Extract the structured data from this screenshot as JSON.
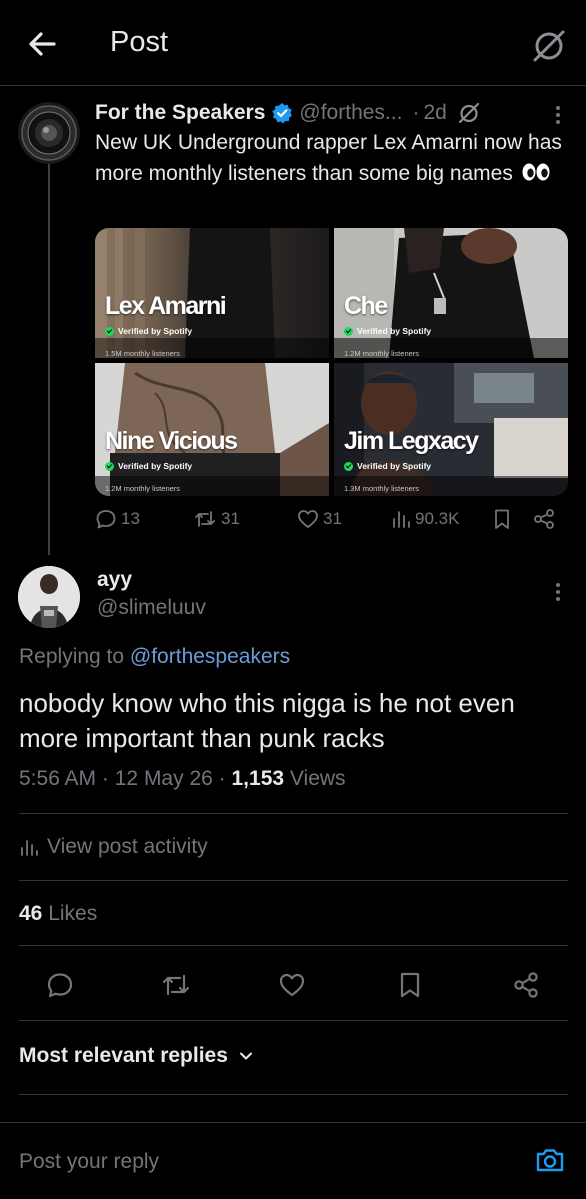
{
  "header": {
    "title": "Post",
    "back_icon": "arrow-left-icon",
    "right_icon": "grok-icon"
  },
  "quoted_tweet": {
    "author_name": "For the Speakers",
    "handle": "@forthes...",
    "time": "2d",
    "separator": "·",
    "text": "New UK Underground rapper Lex Amarni now has more monthly listeners than some big names",
    "emoji": "eyes-emoji",
    "media": [
      {
        "name": "Lex Amarni",
        "verified_text": "Verified by Spotify",
        "listeners": "1.5M monthly listeners"
      },
      {
        "name": "Che",
        "verified_text": "Verified by Spotify",
        "listeners": "1.2M monthly listeners"
      },
      {
        "name": "Nine Vicious",
        "verified_text": "Verified by Spotify",
        "listeners": "1.2M monthly listeners"
      },
      {
        "name": "Jim Legxacy",
        "verified_text": "Verified by Spotify",
        "listeners": "1.3M monthly listeners"
      }
    ],
    "stats": {
      "replies": "13",
      "reposts": "31",
      "likes": "31",
      "views": "90.3K"
    }
  },
  "reply": {
    "author_name": "ayy",
    "handle": "@slimeluuv",
    "replying_prefix": "Replying to",
    "replying_handle": "@forthespeakers",
    "text": "nobody know who this nigga is he not even more important than punk racks",
    "time": "5:56 AM",
    "date": "12 May 26",
    "dot": "·",
    "views_count": "1,153",
    "views_label": "Views"
  },
  "activity": {
    "label": "View post activity"
  },
  "likes_row": {
    "count": "46",
    "label": "Likes"
  },
  "sort": {
    "label": "Most relevant replies"
  },
  "compose": {
    "placeholder": "Post your reply"
  },
  "colors": {
    "background": "#000000",
    "text_primary": "#e7e9ea",
    "text_secondary": "#71767b",
    "link": "#6c9bd9",
    "accent": "#1d9bf0",
    "divider": "#2f3336",
    "spotify_green": "#1ed760"
  }
}
